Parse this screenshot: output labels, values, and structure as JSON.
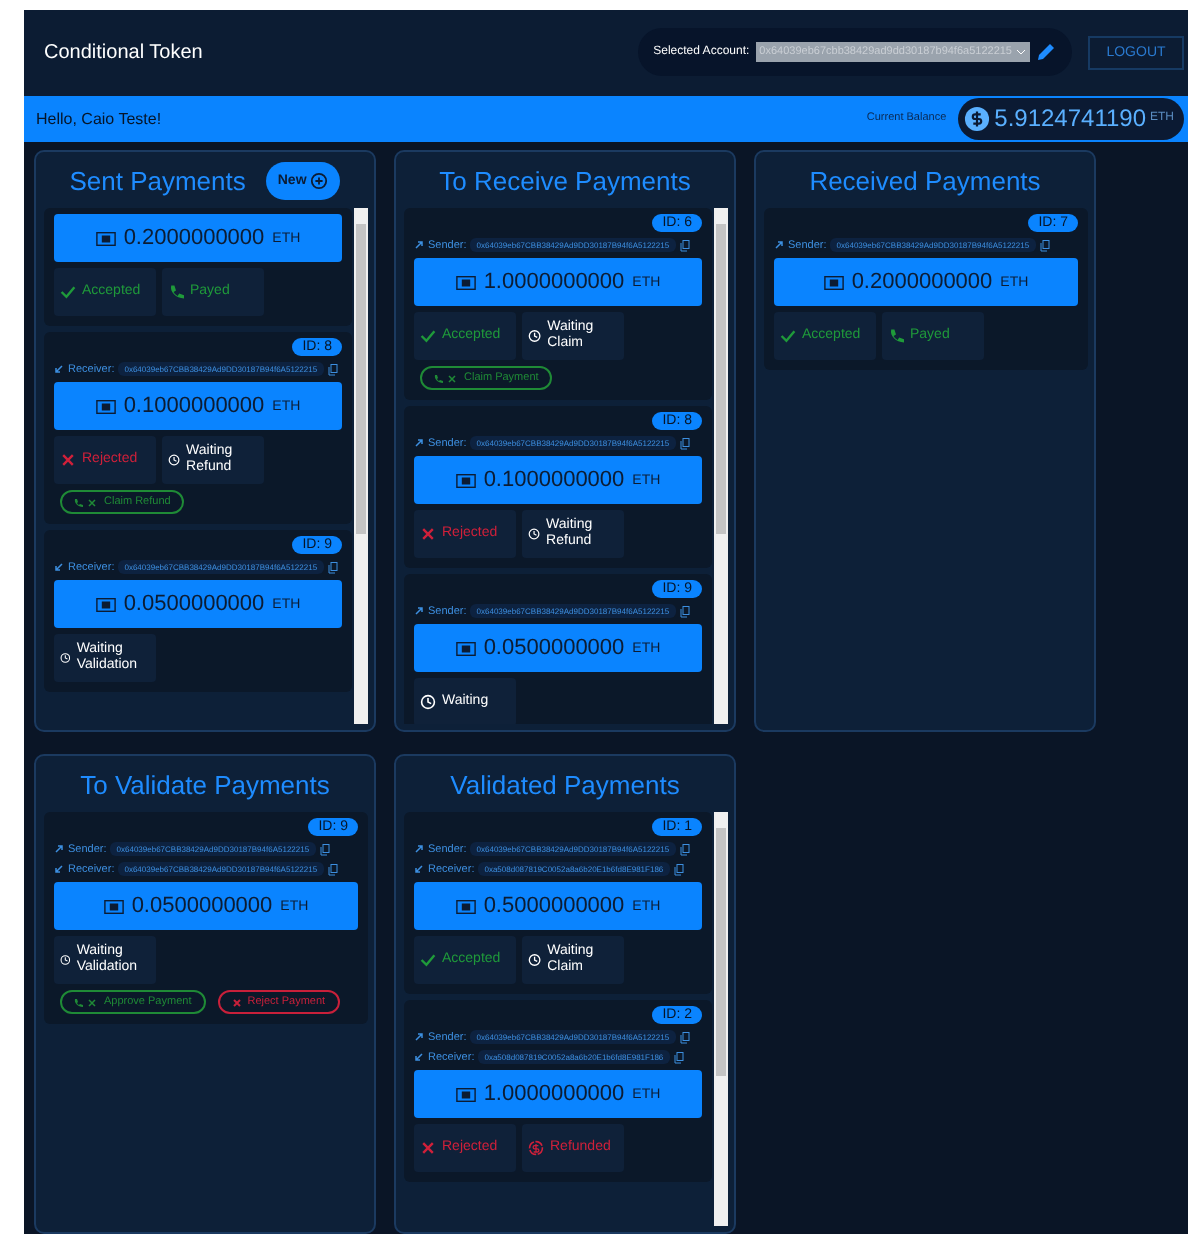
{
  "header": {
    "title": "Conditional Token",
    "account_label": "Selected Account:",
    "account": "0x64039eb67cbb38429ad9dd30187b94f6a5122215",
    "logout": "LOGOUT"
  },
  "greeting_bar": {
    "greeting": "Hello, Caio Teste!",
    "balance_label": "Current Balance",
    "balance": "5.9124741190",
    "unit": "ETH"
  },
  "panels": [
    {
      "title": "Sent Payments",
      "new_button": "New",
      "scrollable": true,
      "cards": [
        {
          "amount": "0.2000000000",
          "unit": "ETH",
          "statuses": [
            {
              "kind": "accepted",
              "label": "Accepted"
            },
            {
              "kind": "payed",
              "label": "Payed"
            }
          ]
        },
        {
          "id": "ID: 8",
          "receiver_label": "Receiver:",
          "receiver": "0x64039eb67CBB38429Ad9DD30187B94f6A5122215",
          "amount": "0.1000000000",
          "unit": "ETH",
          "statuses": [
            {
              "kind": "rejected",
              "label": "Rejected"
            },
            {
              "kind": "waiting",
              "label": "Waiting Refund"
            }
          ],
          "actions": [
            {
              "kind": "approve",
              "label": "Claim Refund"
            }
          ]
        },
        {
          "id": "ID: 9",
          "receiver_label": "Receiver:",
          "receiver": "0x64039eb67CBB38429Ad9DD30187B94f6A5122215",
          "amount": "0.0500000000",
          "unit": "ETH",
          "statuses": [
            {
              "kind": "waiting",
              "label": "Waiting Validation"
            }
          ]
        }
      ]
    },
    {
      "title": "To Receive Payments",
      "scrollable": true,
      "cards": [
        {
          "id": "ID: 6",
          "sender_label": "Sender:",
          "sender": "0x64039eb67CBB38429Ad9DD30187B94f6A5122215",
          "amount": "1.0000000000",
          "unit": "ETH",
          "statuses": [
            {
              "kind": "accepted",
              "label": "Accepted"
            },
            {
              "kind": "waiting",
              "label": "Waiting Claim"
            }
          ],
          "actions": [
            {
              "kind": "approve",
              "label": "Claim Payment"
            }
          ]
        },
        {
          "id": "ID: 8",
          "sender_label": "Sender:",
          "sender": "0x64039eb67CBB38429Ad9DD30187B94f6A5122215",
          "amount": "0.1000000000",
          "unit": "ETH",
          "statuses": [
            {
              "kind": "rejected",
              "label": "Rejected"
            },
            {
              "kind": "waiting",
              "label": "Waiting Refund"
            }
          ]
        },
        {
          "id": "ID: 9",
          "sender_label": "Sender:",
          "sender": "0x64039eb67CBB38429Ad9DD30187B94f6A5122215",
          "amount": "0.0500000000",
          "unit": "ETH",
          "statuses": [
            {
              "kind": "waiting",
              "label": "Waiting"
            }
          ]
        }
      ]
    },
    {
      "title": "Received Payments",
      "scrollable": false,
      "cards": [
        {
          "id": "ID: 7",
          "sender_label": "Sender:",
          "sender": "0x64039eb67CBB38429Ad9DD30187B94f6A5122215",
          "amount": "0.2000000000",
          "unit": "ETH",
          "statuses": [
            {
              "kind": "accepted",
              "label": "Accepted"
            },
            {
              "kind": "payed",
              "label": "Payed"
            }
          ]
        }
      ]
    },
    {
      "title": "To Validate Payments",
      "scrollable": false,
      "cards": [
        {
          "id": "ID: 9",
          "sender_label": "Sender:",
          "sender": "0x64039eb67CBB38429Ad9DD30187B94f6A5122215",
          "receiver_label": "Receiver:",
          "receiver": "0x64039eb67CBB38429Ad9DD30187B94f6A5122215",
          "amount": "0.0500000000",
          "unit": "ETH",
          "statuses": [
            {
              "kind": "waiting",
              "label": "Waiting Validation"
            }
          ],
          "actions": [
            {
              "kind": "approve",
              "label": "Approve Payment"
            },
            {
              "kind": "reject",
              "label": "Reject Payment"
            }
          ]
        }
      ]
    },
    {
      "title": "Validated Payments",
      "scrollable": true,
      "cards": [
        {
          "id": "ID: 1",
          "sender_label": "Sender:",
          "sender": "0x64039eb67CBB38429Ad9DD30187B94f6A5122215",
          "receiver_label": "Receiver:",
          "receiver": "0xa508d087819C0052a8a6b20E1b6fd8E981F186",
          "amount": "0.5000000000",
          "unit": "ETH",
          "statuses": [
            {
              "kind": "accepted",
              "label": "Accepted"
            },
            {
              "kind": "waiting",
              "label": "Waiting Claim"
            }
          ]
        },
        {
          "id": "ID: 2",
          "sender_label": "Sender:",
          "sender": "0x64039eb67CBB38429Ad9DD30187B94f6A5122215",
          "receiver_label": "Receiver:",
          "receiver": "0xa508d087819C0052a8a6b20E1b6fd8E981F186",
          "amount": "1.0000000000",
          "unit": "ETH",
          "statuses": [
            {
              "kind": "rejected",
              "label": "Rejected"
            },
            {
              "kind": "refunded",
              "label": "Refunded"
            }
          ]
        }
      ]
    }
  ]
}
